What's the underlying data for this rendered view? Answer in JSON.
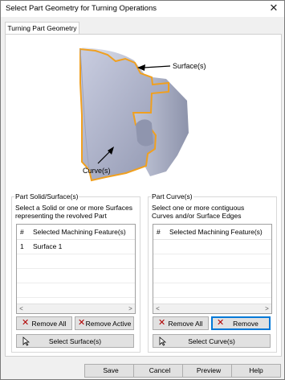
{
  "window": {
    "title": "Select Part Geometry for Turning Operations"
  },
  "tab": {
    "label": "Turning Part Geometry"
  },
  "illustration": {
    "surface_label": "Surface(s)",
    "curve_label": "Curve(s)"
  },
  "solid_group": {
    "label": "Part Solid/Surface(s)",
    "description_line1": "Select a Solid or one or more Surfaces",
    "description_line2": "representing the revolved Part",
    "columns": [
      "#",
      "Selected Machining Feature(s)"
    ],
    "rows": [
      {
        "num": "1",
        "feature": "Surface 1"
      }
    ],
    "remove_all_label": "Remove All",
    "remove_label": "Remove Active",
    "select_label": "Select Surface(s)"
  },
  "curve_group": {
    "label": "Part Curve(s)",
    "description_line1": "Select one or more contiguous",
    "description_line2": "Curves and/or Surface Edges",
    "columns": [
      "#",
      "Selected Machining Feature(s)"
    ],
    "rows": [],
    "remove_all_label": "Remove All",
    "remove_label": "Remove",
    "select_label": "Select Curve(s)"
  },
  "dialog_buttons": {
    "save": "Save",
    "cancel": "Cancel",
    "preview": "Preview",
    "help": "Help"
  }
}
